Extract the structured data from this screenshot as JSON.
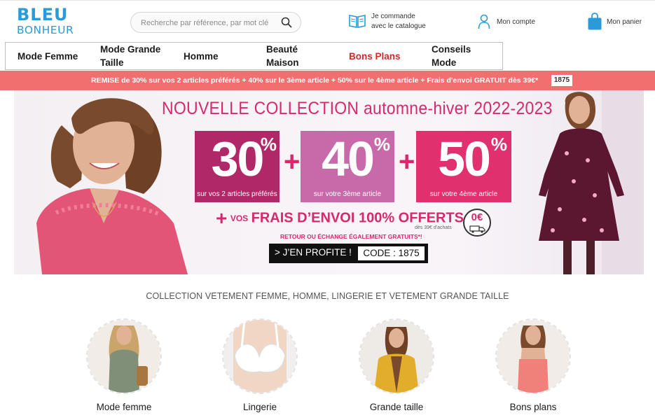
{
  "header": {
    "logo_line1": "BLEU",
    "logo_line2": "BONHEUR",
    "search_placeholder": "Recherche par référence, par mot clé",
    "catalogue_line1": "Je commande",
    "catalogue_line2": "avec le catalogue",
    "account_label": "Mon compte",
    "cart_label": "Mon panier",
    "brand_color": "#2a9bd6"
  },
  "nav": {
    "items": [
      {
        "label": "Mode Femme"
      },
      {
        "label": "Mode Grande Taille"
      },
      {
        "label": "Homme"
      },
      {
        "label": "Beauté Maison"
      },
      {
        "label": "Bons Plans"
      },
      {
        "label": "Conseils Mode"
      }
    ]
  },
  "promo": {
    "text": "REMISE de 30% sur vos 2 articles préférés + 40% sur le 3ème article + 50% sur le 4ème article + Frais d'envoi GRATUIT dès 39€*",
    "code": "1875",
    "color": "#f26f6f"
  },
  "banner": {
    "headline": "NOUVELLE COLLECTION automne-hiver 2022-2023",
    "tiles": [
      {
        "value": "30",
        "unit": "%",
        "caption": "sur vos 2 articles préférés",
        "color": "#b02868"
      },
      {
        "value": "40",
        "unit": "%",
        "caption": "sur votre 3ème article",
        "color": "#c86aaa"
      },
      {
        "value": "50",
        "unit": "%",
        "caption": "sur votre 4ème article",
        "color": "#e0306d"
      }
    ],
    "plus": "+",
    "offer_vos": "VOS",
    "offer_main": "FRAIS D’ENVOI 100% OFFERTS",
    "offer_zero": "0€",
    "offer_min": "dès 39€ d'achats",
    "retour": "RETOUR OU ÉCHANGE ÉGALEMENT GRATUITS*!",
    "cta_label": "> J’EN PROFITE !",
    "cta_code": "CODE : 1875",
    "accent": "#d8286e"
  },
  "collection": {
    "title": "COLLECTION VETEMENT FEMME, HOMME, LINGERIE ET VETEMENT GRANDE TAILLE",
    "categories": [
      {
        "label": "Mode femme"
      },
      {
        "label": "Lingerie"
      },
      {
        "label": "Grande taille"
      },
      {
        "label": "Bons plans"
      }
    ]
  }
}
